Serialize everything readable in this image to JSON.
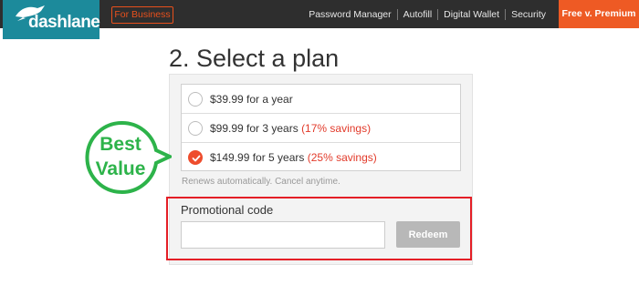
{
  "brand": {
    "name": "dashlane",
    "logo_icon": "dashlane-bird-icon",
    "color": "#1c8a9b"
  },
  "header": {
    "business_button": "For Business",
    "nav": [
      "Password Manager",
      "Autofill",
      "Digital Wallet",
      "Security"
    ],
    "premium_button": "Free v. Premium",
    "accent_color": "#ee5a24"
  },
  "page": {
    "title": "2. Select a plan"
  },
  "plans": [
    {
      "price": "$39.99 for a year",
      "savings": "",
      "selected": false
    },
    {
      "price": "$99.99 for 3 years ",
      "savings": "(17% savings)",
      "selected": false
    },
    {
      "price": "$149.99 for 5 years ",
      "savings": "(25% savings)",
      "selected": true
    }
  ],
  "renews_note": "Renews automatically. Cancel anytime.",
  "badge": {
    "line1": "Best",
    "line2": "Value",
    "color": "#2db34a"
  },
  "promo": {
    "label": "Promotional code",
    "value": "",
    "placeholder": "",
    "redeem_label": "Redeem",
    "highlight_color": "#e41e26"
  }
}
